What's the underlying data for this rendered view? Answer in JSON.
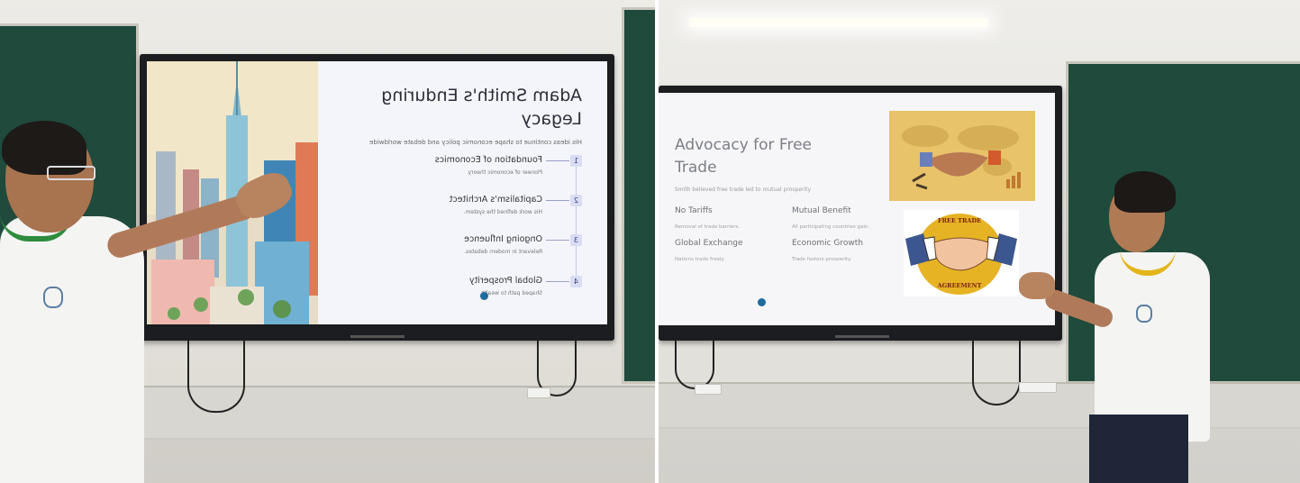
{
  "left_slide": {
    "title_line1": "Adam Smith's Enduring",
    "title_line2": "Legacy",
    "subtitle": "His ideas continue to shape economic policy and debate worldwide",
    "items": [
      {
        "number": "1",
        "title": "Foundation of Economics",
        "desc": "Pioneer of economic theory."
      },
      {
        "number": "2",
        "title": "Capitalism's Architect",
        "desc": "His work defined the system."
      },
      {
        "number": "3",
        "title": "Ongoing Influence",
        "desc": "Relevant in modern debates."
      },
      {
        "number": "4",
        "title": "Global Prosperity",
        "desc": "Shaped path to wealth."
      }
    ]
  },
  "right_slide": {
    "title_line1": "Advocacy for Free",
    "title_line2": "Trade",
    "subtitle": "Smith believed free trade led to mutual prosperity",
    "items": [
      {
        "title": "No Tariffs",
        "desc": "Removal of trade barriers."
      },
      {
        "title": "Mutual Benefit",
        "desc": "All participating countries gain."
      },
      {
        "title": "Global Exchange",
        "desc": "Nations trade freely."
      },
      {
        "title": "Economic Growth",
        "desc": "Trade fosters prosperity."
      }
    ],
    "badge_top": "FREE TRADE",
    "badge_bottom": "AGREEMENT"
  },
  "colors": {
    "chalkboard": "#1f4a3c",
    "slide_accent": "#d9dcf3",
    "shirt": "#f4f4f2",
    "collar_left": "#2e8b3e",
    "collar_right": "#e2b51a"
  }
}
